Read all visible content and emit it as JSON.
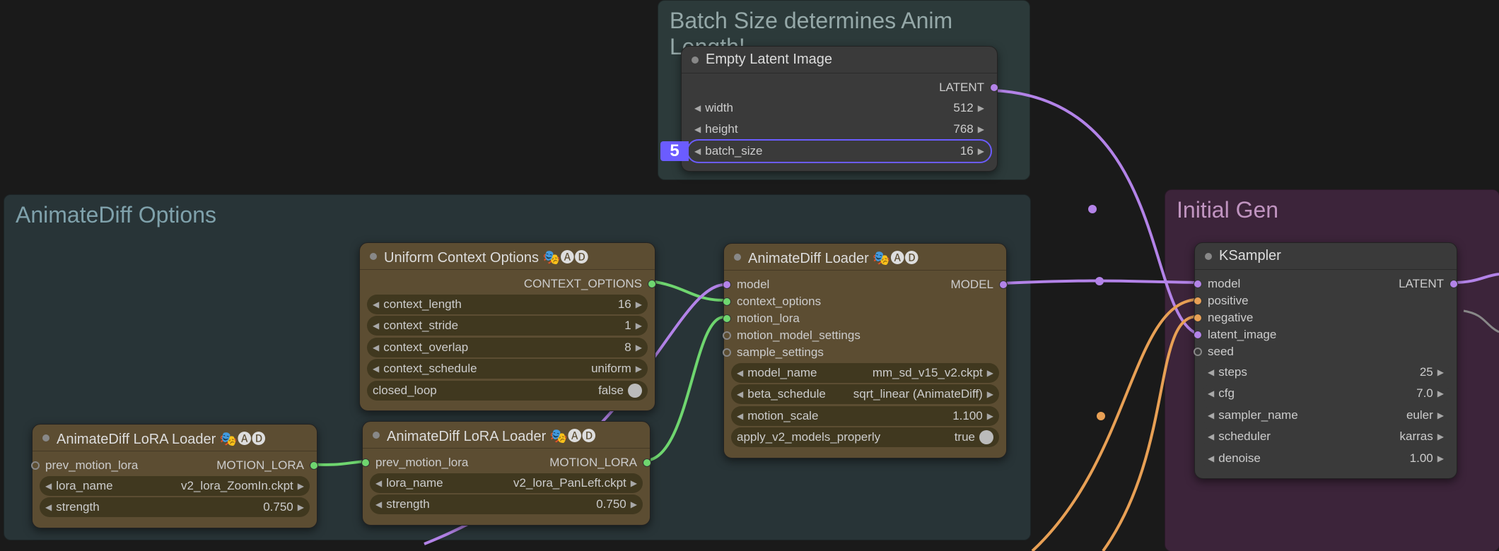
{
  "groups": {
    "batch": {
      "title": "Batch Size determines Anim Length!"
    },
    "anim": {
      "title": "AnimateDiff Options"
    },
    "initial": {
      "title": "Initial Gen"
    }
  },
  "nodes": {
    "latent": {
      "title": "Empty Latent Image",
      "outputs": {
        "latent": "LATENT"
      },
      "widgets": {
        "width": {
          "label": "width",
          "value": "512"
        },
        "height": {
          "label": "height",
          "value": "768"
        },
        "batch": {
          "label": "batch_size",
          "value": "16",
          "badge": "5"
        }
      }
    },
    "context": {
      "title": "Uniform Context Options 🎭🅐🅓",
      "outputs": {
        "context_options": "CONTEXT_OPTIONS"
      },
      "widgets": {
        "length": {
          "label": "context_length",
          "value": "16"
        },
        "stride": {
          "label": "context_stride",
          "value": "1"
        },
        "overlap": {
          "label": "context_overlap",
          "value": "8"
        },
        "schedule": {
          "label": "context_schedule",
          "value": "uniform"
        },
        "loop": {
          "label": "closed_loop",
          "value": "false"
        }
      }
    },
    "loader": {
      "title": "AnimateDiff Loader 🎭🅐🅓",
      "inputs": {
        "model": "model",
        "context_options": "context_options",
        "motion_lora": "motion_lora",
        "motion_model_settings": "motion_model_settings",
        "sample_settings": "sample_settings"
      },
      "outputs": {
        "model": "MODEL"
      },
      "widgets": {
        "model_name": {
          "label": "model_name",
          "value": "mm_sd_v15_v2.ckpt"
        },
        "beta": {
          "label": "beta_schedule",
          "value": "sqrt_linear (AnimateDiff)"
        },
        "motion_scale": {
          "label": "motion_scale",
          "value": "1.100"
        },
        "apply_v2": {
          "label": "apply_v2_models_properly",
          "value": "true"
        }
      }
    },
    "lora1": {
      "title": "AnimateDiff LoRA Loader 🎭🅐🅓",
      "inputs": {
        "prev": "prev_motion_lora"
      },
      "outputs": {
        "motion_lora": "MOTION_LORA"
      },
      "widgets": {
        "name": {
          "label": "lora_name",
          "value": "v2_lora_ZoomIn.ckpt"
        },
        "strength": {
          "label": "strength",
          "value": "0.750"
        }
      }
    },
    "lora2": {
      "title": "AnimateDiff LoRA Loader 🎭🅐🅓",
      "inputs": {
        "prev": "prev_motion_lora"
      },
      "outputs": {
        "motion_lora": "MOTION_LORA"
      },
      "widgets": {
        "name": {
          "label": "lora_name",
          "value": "v2_lora_PanLeft.ckpt"
        },
        "strength": {
          "label": "strength",
          "value": "0.750"
        }
      }
    },
    "ksampler": {
      "title": "KSampler",
      "inputs": {
        "model": "model",
        "positive": "positive",
        "negative": "negative",
        "latent_image": "latent_image",
        "seed": "seed"
      },
      "outputs": {
        "latent": "LATENT"
      },
      "widgets": {
        "steps": {
          "label": "steps",
          "value": "25"
        },
        "cfg": {
          "label": "cfg",
          "value": "7.0"
        },
        "sampler": {
          "label": "sampler_name",
          "value": "euler"
        },
        "sched": {
          "label": "scheduler",
          "value": "karras"
        },
        "denoise": {
          "label": "denoise",
          "value": "1.00"
        }
      }
    }
  }
}
